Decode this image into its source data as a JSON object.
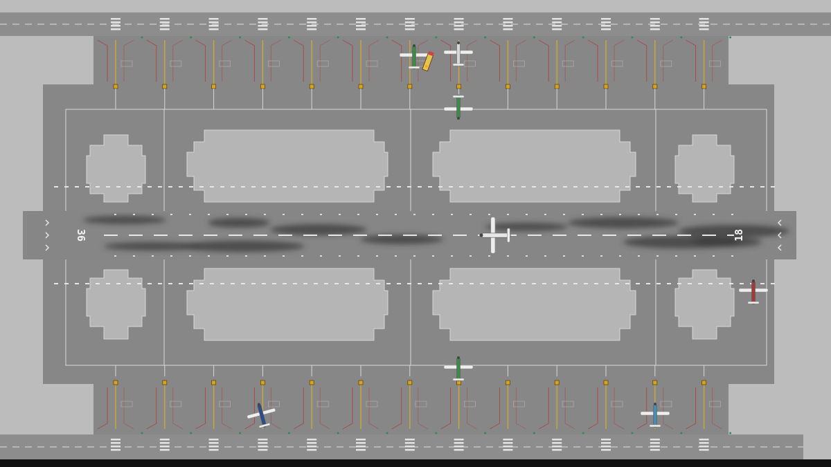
{
  "scene": {
    "type": "airport-top-down",
    "runway": {
      "heading_labels": [
        "36",
        "18"
      ],
      "centerline_color": "#e8e8e8",
      "skid_mark_color": "#3b3b3b"
    },
    "gates": {
      "top_count": 13,
      "bottom_count": 13
    },
    "colors": {
      "ground": "#bcbcbc",
      "tarmac": "#8b8b8b",
      "apron": "#858585",
      "grass_island": "#b6b6b6",
      "line_white": "#e4e4e4",
      "line_yellow": "#c8a63a",
      "stand_red": "#a84a4a"
    }
  },
  "aircraft": [
    {
      "id": "plane-gate-top-green",
      "color": "#3f8a4a",
      "status": "parked",
      "heading": "south"
    },
    {
      "id": "plane-gate-top-white",
      "color": "#d9d9d9",
      "status": "parked",
      "heading": "south"
    },
    {
      "id": "plane-taxi-top-green",
      "color": "#3f8a4a",
      "status": "taxiing",
      "heading": "south"
    },
    {
      "id": "plane-runway-white",
      "color": "#e6e6e6",
      "status": "landing",
      "heading": "east"
    },
    {
      "id": "plane-red-east",
      "color": "#a23a3a",
      "status": "taxiing",
      "heading": "north"
    },
    {
      "id": "plane-taxi-bottom-green",
      "color": "#3f8a4a",
      "status": "taxiing",
      "heading": "north"
    },
    {
      "id": "plane-gate-bottom-blue",
      "color": "#2c4d88",
      "status": "parked",
      "heading": "north"
    },
    {
      "id": "plane-gate-bottom-lightblue",
      "color": "#4a8bb0",
      "status": "parked",
      "heading": "north"
    }
  ],
  "service_vehicle": {
    "id": "fuel-truck",
    "color": "#e2c84a"
  }
}
